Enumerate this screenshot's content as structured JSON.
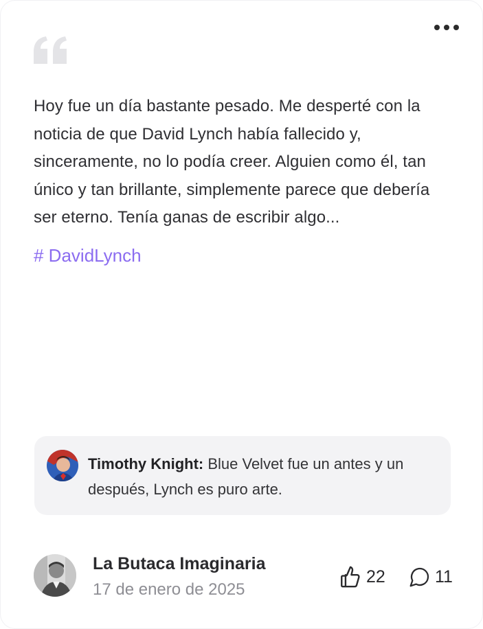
{
  "post": {
    "text": "Hoy fue un día bastante pesado. Me desperté con la noticia de que David Lynch había fallecido y, sinceramente, no lo podía creer. Alguien como él, tan único y tan brillante, simplemente parece que debería ser eterno. Tenía ganas de escribir algo...",
    "hashtag": "# DavidLynch"
  },
  "featured_comment": {
    "author": "Timothy Knight:",
    "text": " Blue Velvet fue un antes y un después, Lynch es puro arte."
  },
  "author": {
    "name": "La Butaca Imaginaria",
    "date": "17 de enero de 2025"
  },
  "stats": {
    "likes": "22",
    "comments": "11"
  },
  "icons": {
    "more": "more-horizontal-icon",
    "quote": "quote-icon",
    "like": "thumbs-up-icon",
    "comment": "message-circle-icon"
  },
  "colors": {
    "accent": "#8b6cf0",
    "text": "#2f2f33",
    "muted": "#8e8e94",
    "comment_bg": "#f3f3f5"
  }
}
